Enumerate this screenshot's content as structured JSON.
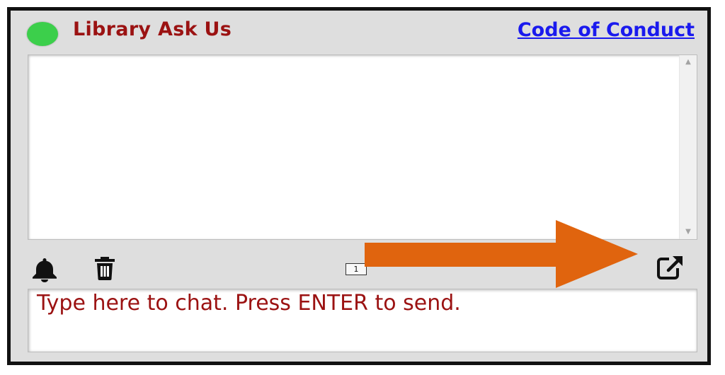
{
  "header": {
    "title": "Library Ask Us",
    "status": "online",
    "status_color": "#3ccf4b",
    "code_of_conduct_link": "Code of Conduct"
  },
  "toolbar": {
    "notifications_icon": "bell-icon",
    "clear_icon": "trash-icon",
    "unread_count": "1",
    "popout_icon": "external-link-icon"
  },
  "chat_input": {
    "placeholder": "Type here to chat. Press ENTER to send.",
    "value": ""
  },
  "annotation": {
    "arrow_color": "#e0640e",
    "points_to": "popout-icon"
  }
}
